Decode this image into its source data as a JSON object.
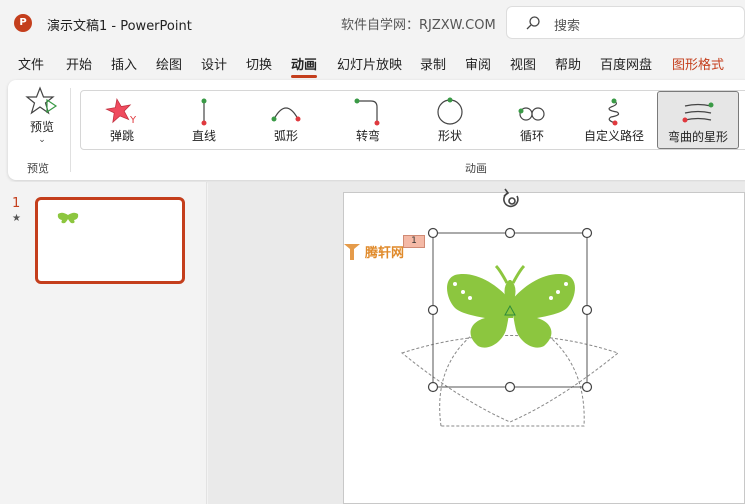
{
  "window": {
    "app_logo": "P",
    "document_title": "演示文稿1  -  PowerPoint",
    "site_note": "软件自学网：RJZXW.COM",
    "search_label": "搜索"
  },
  "menu": {
    "tabs": [
      {
        "label": "文件"
      },
      {
        "label": "开始"
      },
      {
        "label": "插入"
      },
      {
        "label": "绘图"
      },
      {
        "label": "设计"
      },
      {
        "label": "切换"
      },
      {
        "label": "动画",
        "active": true
      },
      {
        "label": "幻灯片放映"
      },
      {
        "label": "录制"
      },
      {
        "label": "审阅"
      },
      {
        "label": "视图"
      },
      {
        "label": "帮助"
      },
      {
        "label": "百度网盘"
      },
      {
        "label": "图形格式",
        "special": true
      }
    ]
  },
  "ribbon": {
    "preview_button": "预览",
    "preview_group": "预览",
    "animation_group": "动画",
    "animations": [
      {
        "label": "弹跳",
        "icon": "bounce-star-icon"
      },
      {
        "label": "直线",
        "icon": "line-path-icon"
      },
      {
        "label": "弧形",
        "icon": "arc-path-icon"
      },
      {
        "label": "转弯",
        "icon": "turn-path-icon"
      },
      {
        "label": "形状",
        "icon": "shape-path-icon"
      },
      {
        "label": "循环",
        "icon": "loop-path-icon"
      },
      {
        "label": "自定义路径",
        "icon": "custom-path-icon"
      },
      {
        "label": "弯曲的星形",
        "icon": "curvy-star-icon",
        "selected": true
      }
    ]
  },
  "slides": {
    "number": "1",
    "has_animation_marker": "★"
  },
  "canvas": {
    "sequence_badge": "1",
    "watermark": "腾轩网"
  },
  "colors": {
    "accent": "#c43e1c",
    "butterfly": "#8cc63f",
    "path_start": "#3a9a46",
    "path_end": "#e0393e"
  }
}
